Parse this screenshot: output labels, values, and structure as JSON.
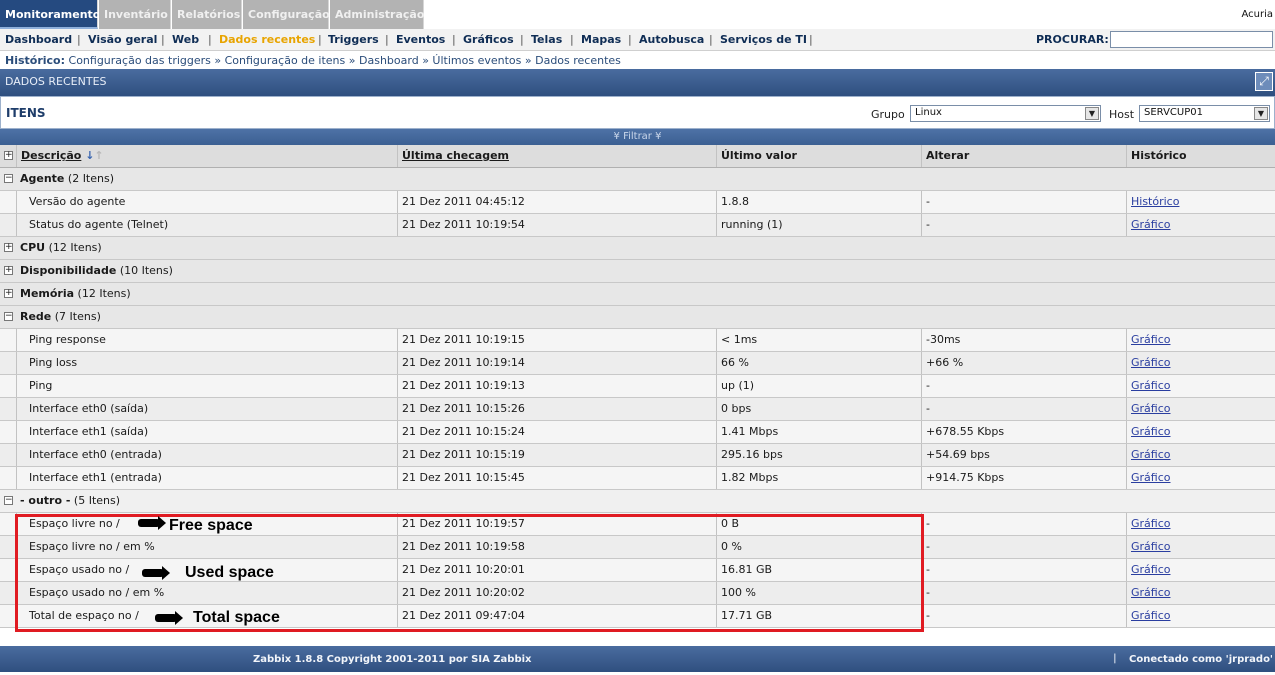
{
  "topmenu": {
    "tabs": [
      "Monitoramento",
      "Inventário",
      "Relatórios",
      "Configuração",
      "Administração"
    ],
    "user_corner": "Acuria"
  },
  "submenu": {
    "items": [
      "Dashboard",
      "Visão geral",
      "Web",
      "Dados recentes",
      "Triggers",
      "Eventos",
      "Gráficos",
      "Telas",
      "Mapas",
      "Autobusca",
      "Serviços de TI"
    ],
    "active": "Dados recentes",
    "search_label": "PROCURAR:",
    "search_value": ""
  },
  "history": {
    "label": "Histórico:",
    "crumbs": [
      "Configuração das triggers",
      "Configuração de itens",
      "Dashboard",
      "Últimos eventos",
      "Dados recentes"
    ],
    "separator": "»"
  },
  "pagebar": {
    "title": "DADOS RECENTES"
  },
  "itens": {
    "title": "ITENS",
    "group_label": "Grupo",
    "group_value": "Linux",
    "host_label": "Host",
    "host_value": "SERVCUP01"
  },
  "filter": {
    "label": "Filtrar"
  },
  "table": {
    "headers": [
      "Descrição",
      "Última checagem",
      "Último valor",
      "Alterar",
      "Histórico"
    ],
    "groups": [
      {
        "name": "Agente",
        "count": "(2 Itens)",
        "expanded": true,
        "rows": [
          [
            "Versão do agente",
            "21 Dez 2011 04:45:12",
            "1.8.8",
            "-",
            "Histórico"
          ],
          [
            "Status do agente (Telnet)",
            "21 Dez 2011 10:19:54",
            "running (1)",
            "-",
            "Gráfico"
          ]
        ]
      },
      {
        "name": "CPU",
        "count": "(12 Itens)",
        "expanded": false,
        "rows": []
      },
      {
        "name": "Disponibilidade",
        "count": "(10 Itens)",
        "expanded": false,
        "rows": []
      },
      {
        "name": "Memória",
        "count": "(12 Itens)",
        "expanded": false,
        "rows": []
      },
      {
        "name": "Rede",
        "count": "(7 Itens)",
        "expanded": true,
        "rows": [
          [
            "Ping response",
            "21 Dez 2011 10:19:15",
            "< 1ms",
            "-30ms",
            "Gráfico"
          ],
          [
            "Ping loss",
            "21 Dez 2011 10:19:14",
            "66 %",
            "+66 %",
            "Gráfico"
          ],
          [
            "Ping",
            "21 Dez 2011 10:19:13",
            "up (1)",
            "-",
            "Gráfico"
          ],
          [
            "Interface eth0 (saída)",
            "21 Dez 2011 10:15:26",
            "0 bps",
            "-",
            "Gráfico"
          ],
          [
            "Interface eth1 (saída)",
            "21 Dez 2011 10:15:24",
            "1.41 Mbps",
            "+678.55 Kbps",
            "Gráfico"
          ],
          [
            "Interface eth0 (entrada)",
            "21 Dez 2011 10:15:19",
            "295.16 bps",
            "+54.69 bps",
            "Gráfico"
          ],
          [
            "Interface eth1 (entrada)",
            "21 Dez 2011 10:15:45",
            "1.82 Mbps",
            "+914.75 Kbps",
            "Gráfico"
          ]
        ]
      },
      {
        "name": "- outro -",
        "count": "(5 Itens)",
        "expanded": true,
        "rows": [
          [
            "Espaço livre no /",
            "21 Dez 2011 10:19:57",
            "0 B",
            "-",
            "Gráfico"
          ],
          [
            "Espaço livre no / em %",
            "21 Dez 2011 10:19:58",
            "0 %",
            "-",
            "Gráfico"
          ],
          [
            "Espaço usado no /",
            "21 Dez 2011 10:20:01",
            "16.81 GB",
            "-",
            "Gráfico"
          ],
          [
            "Espaço usado no / em %",
            "21 Dez 2011 10:20:02",
            "100 %",
            "-",
            "Gráfico"
          ],
          [
            "Total de espaço no /",
            "21 Dez 2011 09:47:04",
            "17.71 GB",
            "-",
            "Gráfico"
          ]
        ]
      }
    ]
  },
  "annotations": {
    "free_space": "Free space",
    "used_space": "Used space",
    "total_space": "Total space",
    "box_color": "#e01b22"
  },
  "footer": {
    "copyright": "Zabbix 1.8.8 Copyright 2001-2011 por SIA Zabbix",
    "separator": "|",
    "connected": "Conectado como 'jrprado'"
  },
  "colors": {
    "header_blue": "#254a80",
    "active_submenu": "#e8a400",
    "link": "#2a3ea0"
  }
}
